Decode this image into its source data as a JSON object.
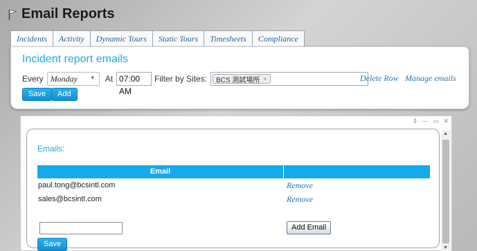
{
  "page": {
    "title": "Email Reports"
  },
  "tabs": [
    "Incidents",
    "Activity",
    "Dynamic Tours",
    "Static Tours",
    "Timesheets",
    "Compliance"
  ],
  "report": {
    "title": "Incident report emails",
    "every_label": "Every",
    "day_value": "Monday",
    "at_label": "At",
    "time_value": "07:00 AM",
    "filter_label": "Filter by Sites:",
    "site_tag": "BCS 測試場所",
    "site_tag_remove": "×",
    "delete_row": "Delete Row",
    "manage_emails": "Manage emails",
    "save_label": "Save",
    "add_label": "Add"
  },
  "frame": {
    "controls": "⇕ — ▭ ✕"
  },
  "emails": {
    "label": "Emails:",
    "header_email": "Email",
    "rows": [
      {
        "email": "paul.tong@bcsintl.com",
        "action": "Remove"
      },
      {
        "email": "sales@bcsintl.com",
        "action": "Remove"
      }
    ],
    "new_email_value": "",
    "add_email_label": "Add Email",
    "save_label": "Save"
  },
  "colors": {
    "accent": "#24a7df",
    "table_header": "#14aaec",
    "link": "#1f73b7"
  }
}
